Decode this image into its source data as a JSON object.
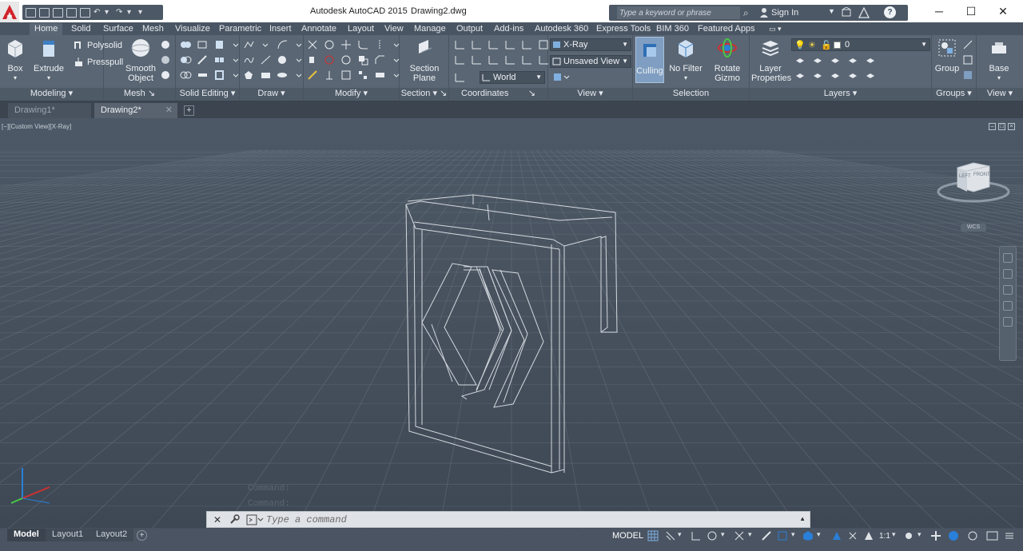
{
  "titlebar": {
    "app_title": "Autodesk AutoCAD 2015",
    "file_name": "Drawing2.dwg",
    "search_placeholder": "Type a keyword or phrase",
    "sign_in": "Sign In"
  },
  "ribbon_tabs": [
    "Home",
    "Solid",
    "Surface",
    "Mesh",
    "Visualize",
    "Parametric",
    "Insert",
    "Annotate",
    "Layout",
    "View",
    "Manage",
    "Output",
    "Add-ins",
    "Autodesk 360",
    "Express Tools",
    "BIM 360",
    "Featured Apps"
  ],
  "ribbon": {
    "modeling": {
      "title": "Modeling",
      "box": "Box",
      "extrude": "Extrude",
      "polysolid": "Polysolid",
      "presspull": "Presspull"
    },
    "mesh": {
      "title": "Mesh",
      "smooth_object_1": "Smooth",
      "smooth_object_2": "Object"
    },
    "solid_editing": {
      "title": "Solid Editing"
    },
    "draw": {
      "title": "Draw"
    },
    "modify": {
      "title": "Modify"
    },
    "section": {
      "title": "Section",
      "section_plane_1": "Section",
      "section_plane_2": "Plane"
    },
    "coordinates": {
      "title": "Coordinates",
      "world": "World"
    },
    "view": {
      "title": "View",
      "visual_style": "X-Ray",
      "saved_view": "Unsaved View"
    },
    "selection": {
      "title": "Selection",
      "culling": "Culling",
      "no_filter": "No Filter",
      "rotate_gizmo_1": "Rotate",
      "rotate_gizmo_2": "Gizmo"
    },
    "layers": {
      "title": "Layers",
      "layer_properties_1": "Layer",
      "layer_properties_2": "Properties",
      "current_layer": "0"
    },
    "groups": {
      "title": "Groups",
      "group": "Group"
    },
    "view2": {
      "title": "View",
      "base": "Base"
    }
  },
  "doc_tabs": [
    {
      "label": "Drawing1*",
      "active": false
    },
    {
      "label": "Drawing2*",
      "active": true
    }
  ],
  "viewport": {
    "label": "[−][Custom View][X-Ray]",
    "viewcube_left": "LEFT",
    "viewcube_front": "FRONT",
    "wcs": "WCS"
  },
  "command": {
    "history": [
      "Command:",
      "Command:"
    ],
    "placeholder": "Type a command"
  },
  "layout_tabs": [
    {
      "label": "Model",
      "active": true
    },
    {
      "label": "Layout1",
      "active": false
    },
    {
      "label": "Layout2",
      "active": false
    }
  ],
  "status": {
    "model": "MODEL",
    "scale": "1:1"
  },
  "colors": {
    "accent": "#7f9ec1",
    "viewport": "#4a5461",
    "ribbon": "#5a6674",
    "app_red": "#d2232a",
    "ucs_blue": "#2a7fd8",
    "ucs_green": "#48c848",
    "ucs_red": "#d03030"
  }
}
